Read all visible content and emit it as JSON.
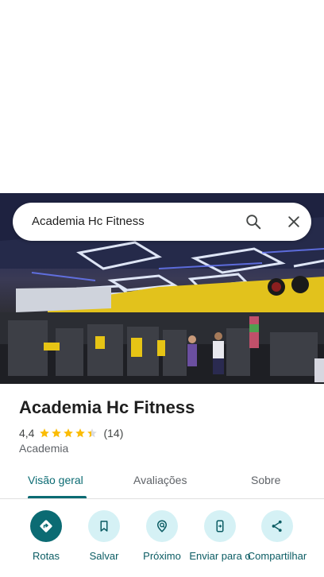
{
  "search": {
    "query": "Academia Hc Fitness"
  },
  "place": {
    "title": "Academia Hc Fitness",
    "rating": "4,4",
    "stars": 4.4,
    "reviews": "(14)",
    "category": "Academia"
  },
  "tabs": [
    {
      "label": "Visão geral",
      "active": true
    },
    {
      "label": "Avaliações",
      "active": false
    },
    {
      "label": "Sobre",
      "active": false
    }
  ],
  "actions": [
    {
      "label": "Rotas",
      "icon": "directions-icon"
    },
    {
      "label": "Salvar",
      "icon": "bookmark-icon"
    },
    {
      "label": "Próximo",
      "icon": "nearby-icon"
    },
    {
      "label": "Enviar para o",
      "icon": "send-to-phone-icon"
    },
    {
      "label": "Compartilhar",
      "icon": "share-icon"
    }
  ],
  "colors": {
    "accent": "#0b6b73",
    "action_bg": "#d5f1f5",
    "star": "#fbbc04"
  }
}
